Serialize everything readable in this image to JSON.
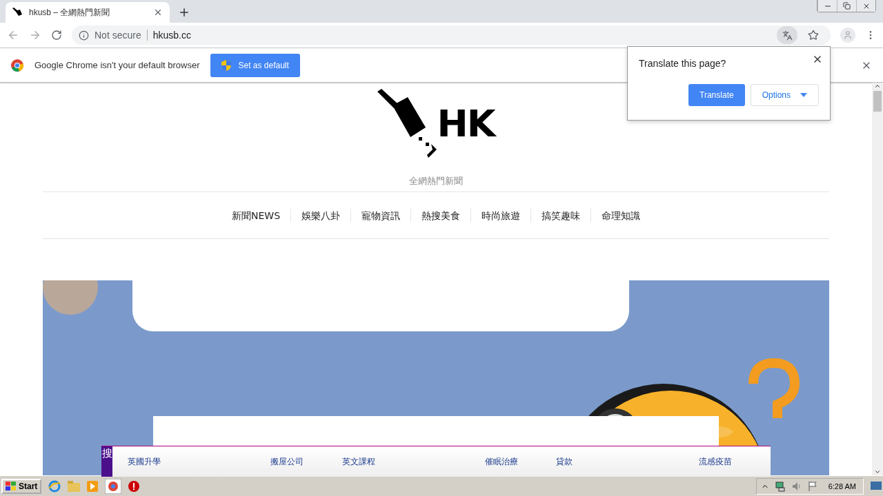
{
  "browser": {
    "tab": {
      "title": "hkusb – 全網熱門新聞",
      "selected": true
    },
    "address": {
      "security": "Not secure",
      "url": "hkusb.cc"
    }
  },
  "infobar": {
    "message": "Google Chrome isn't your default browser",
    "button": "Set as default"
  },
  "translate_popup": {
    "title": "Translate this page?",
    "primary": "Translate",
    "options": "Options"
  },
  "site": {
    "logo_text": "HK",
    "tagline": "全網熱門新聞",
    "nav": [
      {
        "label": "新聞NEWS"
      },
      {
        "label": "娛樂八卦"
      },
      {
        "label": "寵物資訊"
      },
      {
        "label": "熱搜美食"
      },
      {
        "label": "時尚旅遊"
      },
      {
        "label": "搞笑趣味"
      },
      {
        "label": "命理知識"
      }
    ]
  },
  "search_bar": {
    "label": "搜",
    "links": [
      {
        "label": "英國升學"
      },
      {
        "label": "搬屋公司"
      },
      {
        "label": "英文課程"
      },
      {
        "label": "催眠治療"
      },
      {
        "label": "貸款"
      },
      {
        "label": "流感疫苗"
      }
    ]
  },
  "taskbar": {
    "start": "Start",
    "clock": "6:28 AM"
  }
}
